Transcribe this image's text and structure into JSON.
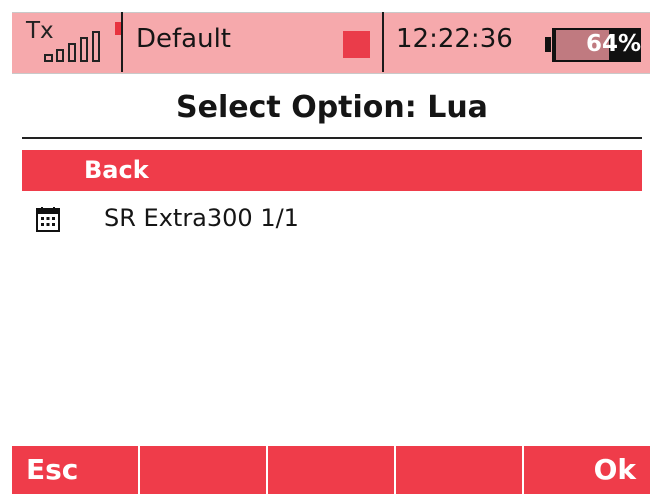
{
  "status": {
    "tx_label": "Tx",
    "signal_bars": 5,
    "profile": "Default",
    "time": "12:22:36",
    "battery_percent_text": "64%",
    "battery_level": 0.64
  },
  "title": "Select Option: Lua",
  "list": {
    "back_label": "Back",
    "items": [
      {
        "icon": "calendar-icon",
        "label": "SR Extra300 1/1"
      }
    ]
  },
  "softkeys": [
    "Esc",
    "",
    "",
    "",
    "Ok"
  ],
  "colors": {
    "accent": "#ef3c4a",
    "status_bg": "#f6a9ac",
    "battery_fill": "#c07a80"
  }
}
